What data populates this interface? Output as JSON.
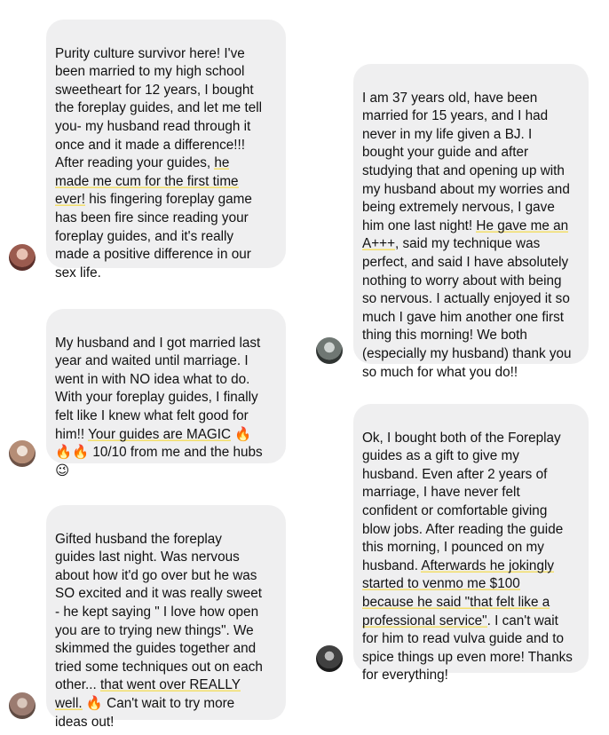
{
  "messages": [
    {
      "segments": [
        {
          "text": "Purity culture survivor here! I've\nbeen married to my high school\nsweetheart for 12 years, I bought\nthe foreplay guides, and let me tell\nyou- my husband read through it\nonce and it made a difference!!!\nAfter reading your guides, ",
          "hl": false
        },
        {
          "text": "he\nmade me cum for the first time\never!",
          "hl": true
        },
        {
          "text": " his fingering foreplay game\nhas been fire since reading your\nforeplay guides, and it's really\nmade a positive difference in our\nsex life.",
          "hl": false
        }
      ]
    },
    {
      "segments": [
        {
          "text": "My husband and I got married last\nyear and waited until marriage. I\nwent in with NO idea what to do.\nWith your foreplay guides, I finally\nfelt like I knew what felt good for\nhim!! ",
          "hl": false
        },
        {
          "text": "Your guides are MAGIC",
          "hl": true
        },
        {
          "text": " 🔥\n🔥🔥 10/10 from me and the hubs\n😉",
          "hl": false
        }
      ]
    },
    {
      "segments": [
        {
          "text": "Gifted husband the foreplay\nguides last night. Was nervous\nabout how it'd go over but he was\nSO excited and it was really sweet\n- he kept saying \" I love how open\nyou are to trying new things\". We\nskimmed the guides together and\ntried some techniques out on each\nother... ",
          "hl": false
        },
        {
          "text": "that went over REALLY\nwell.",
          "hl": true
        },
        {
          "text": " 🔥 Can't wait to try more\nideas out!",
          "hl": false
        }
      ]
    },
    {
      "segments": [
        {
          "text": "I am 37 years old, have been\nmarried for 15 years, and I had\nnever in my life given a BJ. I\nbought your guide and after\nstudying that and opening up with\nmy husband about my worries and\nbeing extremely nervous, I gave\nhim one last night! ",
          "hl": false
        },
        {
          "text": "He gave me an\nA+++",
          "hl": true
        },
        {
          "text": ", said my technique was\nperfect, and said I have absolutely\nnothing to worry about with being\nso nervous. I actually enjoyed it so\nmuch I gave him another one first\nthing this morning! We both\n(especially my husband) thank you\nso much for what you do!!",
          "hl": false
        }
      ]
    },
    {
      "segments": [
        {
          "text": "Ok, I bought both of the Foreplay\nguides as a gift to give my\nhusband. Even after 2 years of\nmarriage, I have never felt\nconfident or comfortable giving\nblow jobs. After reading the guide\nthis morning, I pounced on my\nhusband. ",
          "hl": false
        },
        {
          "text": "Afterwards he jokingly\nstarted to venmo me $100\nbecause he said \"that felt like a\nprofessional service\"",
          "hl": true
        },
        {
          "text": ". I can't wait\nfor him to read vulva guide and to\nspice things up even more! Thanks\nfor everything!",
          "hl": false
        }
      ]
    }
  ]
}
